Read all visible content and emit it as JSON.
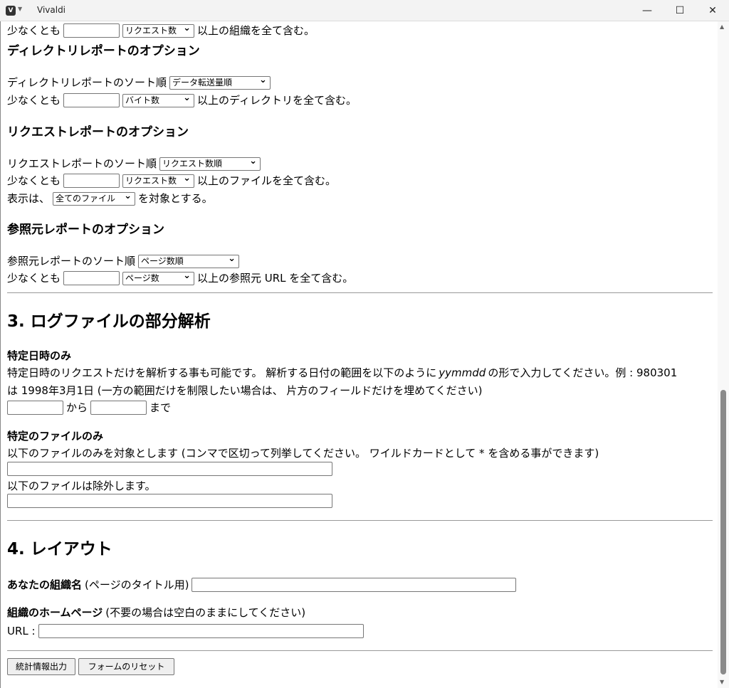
{
  "window": {
    "title": "Vivaldi",
    "minimize": "—",
    "maximize": "☐",
    "close": "✕"
  },
  "cut_row": {
    "prefix": "少なくとも",
    "unit": "リクエスト数",
    "suffix": "以上の組織を全て含む。"
  },
  "dir": {
    "heading": "ディレクトリレポートのオプション",
    "sort_label": "ディレクトリレポートのソート順",
    "sort_value": "データ転送量順",
    "min_prefix": "少なくとも",
    "min_unit": "バイト数",
    "min_suffix": "以上のディレクトリを全て含む。"
  },
  "req": {
    "heading": "リクエストレポートのオプション",
    "sort_label": "リクエストレポートのソート順",
    "sort_value": "リクエスト数順",
    "min_prefix": "少なくとも",
    "min_unit": "リクエスト数",
    "min_suffix": "以上のファイルを全て含む。",
    "show_prefix": "表示は、",
    "show_value": "全てのファイル",
    "show_suffix": "を対象とする。"
  },
  "ref": {
    "heading": "参照元レポートのオプション",
    "sort_label": "参照元レポートのソート順",
    "sort_value": "ページ数順",
    "min_prefix": "少なくとも",
    "min_unit": "ページ数",
    "min_suffix": "以上の参照元 URL を全て含む。"
  },
  "partial": {
    "heading": "3. ログファイルの部分解析",
    "date_heading": "特定日時のみ",
    "date_text1a": "特定日時のリクエストだけを解析する事も可能です。 解析する日付の範囲を以下のように",
    "date_text1_em": "yymmdd",
    "date_text1b": "の形で入力してください。例 : 980301",
    "date_text2": "は 1998年3月1日 (一方の範囲だけを制限したい場合は、 片方のフィールドだけを埋めてください)",
    "from": "から",
    "to": "まで",
    "file_heading": "特定のファイルのみ",
    "include_label": "以下のファイルのみを対象とします (コンマで区切って列挙してください。 ワイルドカードとして * を含める事ができます)",
    "exclude_label": "以下のファイルは除外します。"
  },
  "layout": {
    "heading": "4. レイアウト",
    "org_label": "あなたの組織名",
    "org_note": "(ページのタイトル用)",
    "home_label": "組織のホームページ",
    "home_note": "(不要の場合は空白のままにしてください)",
    "url_label": "URL :"
  },
  "buttons": {
    "submit": "統計情報出力",
    "reset": "フォームのリセット"
  }
}
